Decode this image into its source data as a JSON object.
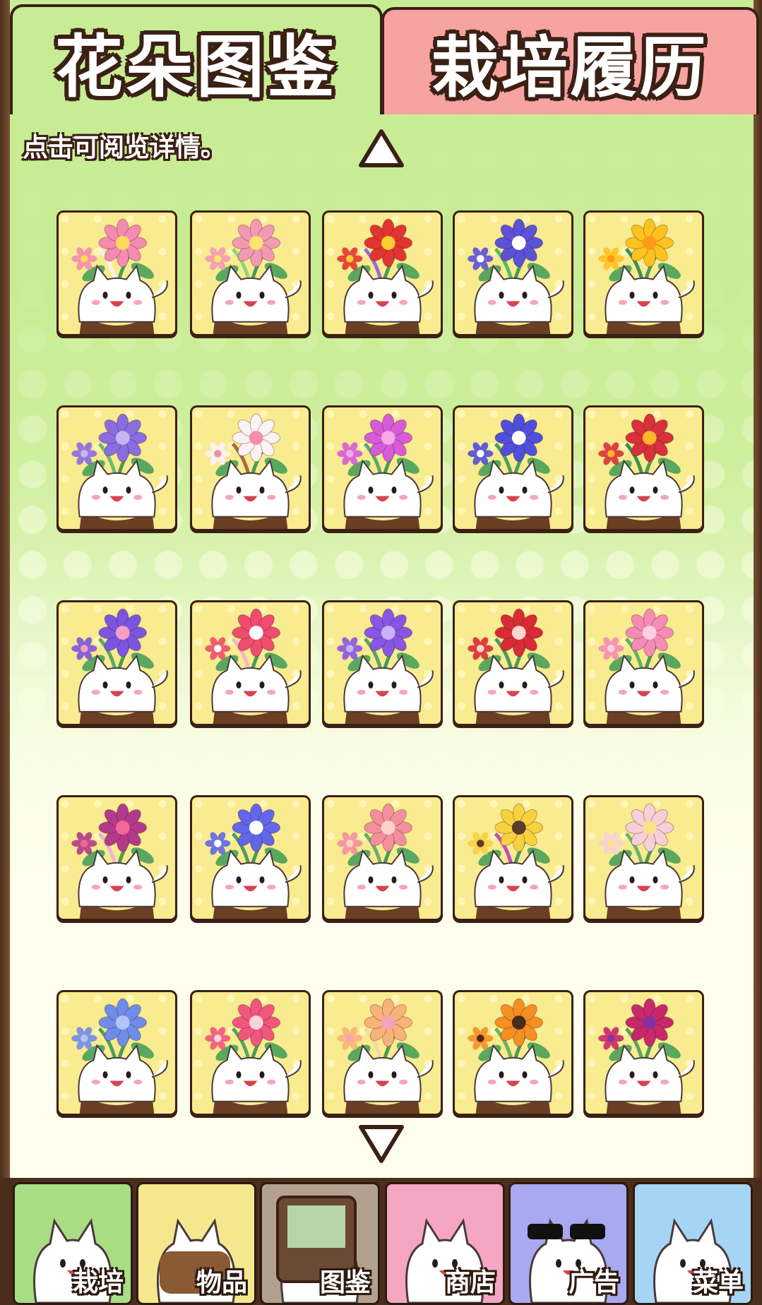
{
  "tabs": [
    {
      "label": "花朵图鉴",
      "active": true
    },
    {
      "label": "栽培履历",
      "active": false
    }
  ],
  "hint": "点击可阅览详情。",
  "flowers": [
    {
      "petal": "#f48bb0",
      "center": "#ffd95a",
      "accent": "#f7f2f5"
    },
    {
      "petal": "#f39ab2",
      "center": "#fbe46e",
      "accent": "#8fd37a"
    },
    {
      "petal": "#e2352f",
      "center": "#ffcc33",
      "accent": "#9a6ae0"
    },
    {
      "petal": "#5b52d8",
      "center": "#ffffff",
      "accent": "#56b86a"
    },
    {
      "petal": "#ffc21f",
      "center": "#ff9a1a",
      "accent": "#3f8f5c"
    },
    {
      "petal": "#8a6de0",
      "center": "#c6b6f4",
      "accent": "#6db870"
    },
    {
      "petal": "#fbf3f3",
      "center": "#f38fa6",
      "accent": "#a36b46"
    },
    {
      "petal": "#d75ad9",
      "center": "#f5a8e6",
      "accent": "#5da96b"
    },
    {
      "petal": "#4f4fdc",
      "center": "#ffffff",
      "accent": "#4f9e5f"
    },
    {
      "petal": "#d8303c",
      "center": "#ffb52b",
      "accent": "#3d8f52"
    },
    {
      "petal": "#7b55e0",
      "center": "#f2a0c0",
      "accent": "#5da96b"
    },
    {
      "petal": "#ef4c6e",
      "center": "#ffffff",
      "accent": "#f7b4c8"
    },
    {
      "petal": "#8756e4",
      "center": "#c9b2f9",
      "accent": "#5aa45f"
    },
    {
      "petal": "#d92b35",
      "center": "#ffd7d0",
      "accent": "#4c9a5a"
    },
    {
      "petal": "#f58cb6",
      "center": "#ffd0e0",
      "accent": "#62b06a"
    },
    {
      "petal": "#b33a8a",
      "center": "#f06898",
      "accent": "#e8b6d8"
    },
    {
      "petal": "#6266ea",
      "center": "#ffffff",
      "accent": "#4f9e5f"
    },
    {
      "petal": "#f38f9d",
      "center": "#fdd3c9",
      "accent": "#69b06a"
    },
    {
      "petal": "#f7d23e",
      "center": "#5b3b2c",
      "accent": "#c44ab9"
    },
    {
      "petal": "#f8cfd8",
      "center": "#fbe08a",
      "accent": "#6ab46a"
    },
    {
      "petal": "#6e8de8",
      "center": "#b4c3f8",
      "accent": "#4f9e5f"
    },
    {
      "petal": "#f0567e",
      "center": "#fbd4df",
      "accent": "#5aa45f"
    },
    {
      "petal": "#f9b37a",
      "center": "#f6a3b4",
      "accent": "#f6d8a0"
    },
    {
      "petal": "#f58f22",
      "center": "#4a2a18",
      "accent": "#72b15a"
    },
    {
      "petal": "#c8286a",
      "center": "#8a2fa0",
      "accent": "#5aa45f"
    }
  ],
  "nav": [
    {
      "label": "栽培",
      "bg": "#a9dd84"
    },
    {
      "label": "物品",
      "bg": "#f5e78e"
    },
    {
      "label": "图鉴",
      "bg": "#b4a08e"
    },
    {
      "label": "商店",
      "bg": "#f4a6c3"
    },
    {
      "label": "广告",
      "bg": "#a8a9f0"
    },
    {
      "label": "菜单",
      "bg": "#a6d4f5"
    }
  ]
}
